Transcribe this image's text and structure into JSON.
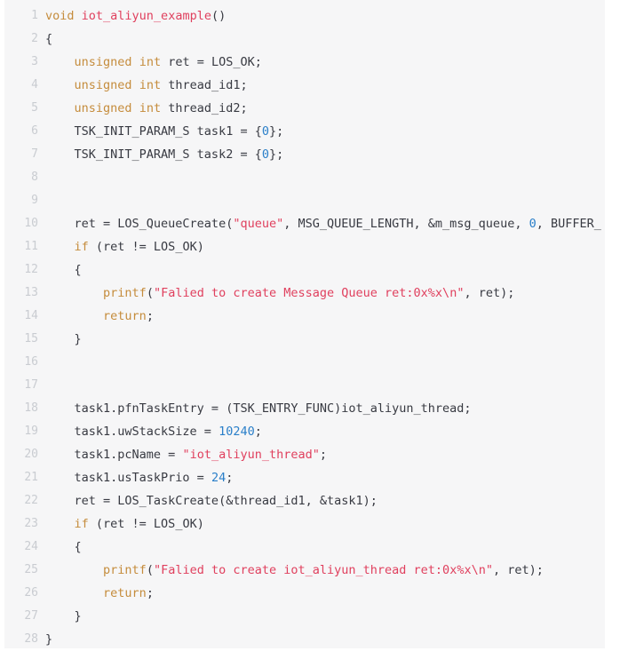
{
  "editor": {
    "language": "c",
    "first_line": 1,
    "last_line": 28,
    "total_lines": 28,
    "background": "#f6f6f7",
    "gutter_color": "#c9ccd1",
    "colors": {
      "keyword": "#c58c3c",
      "function": "#e0405e",
      "string": "#e0405e",
      "number": "#2a7fc9",
      "plain": "#383a42"
    }
  },
  "lines": [
    {
      "number": "1",
      "tokens": [
        {
          "t": "void",
          "c": "t-kw"
        },
        {
          "t": " ",
          "c": "t-pln"
        },
        {
          "t": "iot_aliyun_example",
          "c": "t-fn"
        },
        {
          "t": "()",
          "c": "t-pln"
        }
      ]
    },
    {
      "number": "2",
      "tokens": [
        {
          "t": "{",
          "c": "t-pln"
        }
      ]
    },
    {
      "number": "3",
      "tokens": [
        {
          "t": "    ",
          "c": "t-pln"
        },
        {
          "t": "unsigned",
          "c": "t-kw"
        },
        {
          "t": " ",
          "c": "t-pln"
        },
        {
          "t": "int",
          "c": "t-kw"
        },
        {
          "t": " ret = LOS_OK;",
          "c": "t-pln"
        }
      ]
    },
    {
      "number": "4",
      "tokens": [
        {
          "t": "    ",
          "c": "t-pln"
        },
        {
          "t": "unsigned",
          "c": "t-kw"
        },
        {
          "t": " ",
          "c": "t-pln"
        },
        {
          "t": "int",
          "c": "t-kw"
        },
        {
          "t": " thread_id1;",
          "c": "t-pln"
        }
      ]
    },
    {
      "number": "5",
      "tokens": [
        {
          "t": "    ",
          "c": "t-pln"
        },
        {
          "t": "unsigned",
          "c": "t-kw"
        },
        {
          "t": " ",
          "c": "t-pln"
        },
        {
          "t": "int",
          "c": "t-kw"
        },
        {
          "t": " thread_id2;",
          "c": "t-pln"
        }
      ]
    },
    {
      "number": "6",
      "tokens": [
        {
          "t": "    TSK_INIT_PARAM_S task1 = {",
          "c": "t-pln"
        },
        {
          "t": "0",
          "c": "t-num"
        },
        {
          "t": "};",
          "c": "t-pln"
        }
      ]
    },
    {
      "number": "7",
      "tokens": [
        {
          "t": "    TSK_INIT_PARAM_S task2 = {",
          "c": "t-pln"
        },
        {
          "t": "0",
          "c": "t-num"
        },
        {
          "t": "};",
          "c": "t-pln"
        }
      ]
    },
    {
      "number": "8",
      "tokens": []
    },
    {
      "number": "9",
      "tokens": []
    },
    {
      "number": "10",
      "tokens": [
        {
          "t": "    ret = LOS_QueueCreate(",
          "c": "t-pln"
        },
        {
          "t": "\"queue\"",
          "c": "t-str"
        },
        {
          "t": ", MSG_QUEUE_LENGTH, &m_msg_queue, ",
          "c": "t-pln"
        },
        {
          "t": "0",
          "c": "t-num"
        },
        {
          "t": ", BUFFER_",
          "c": "t-pln"
        }
      ]
    },
    {
      "number": "11",
      "tokens": [
        {
          "t": "    ",
          "c": "t-pln"
        },
        {
          "t": "if",
          "c": "t-kw"
        },
        {
          "t": " (ret != LOS_OK)",
          "c": "t-pln"
        }
      ]
    },
    {
      "number": "12",
      "tokens": [
        {
          "t": "    {",
          "c": "t-pln"
        }
      ]
    },
    {
      "number": "13",
      "tokens": [
        {
          "t": "        ",
          "c": "t-pln"
        },
        {
          "t": "printf",
          "c": "t-kw"
        },
        {
          "t": "(",
          "c": "t-pln"
        },
        {
          "t": "\"Falied to create Message Queue ret:0x%x\\n\"",
          "c": "t-str"
        },
        {
          "t": ", ret);",
          "c": "t-pln"
        }
      ]
    },
    {
      "number": "14",
      "tokens": [
        {
          "t": "        ",
          "c": "t-pln"
        },
        {
          "t": "return",
          "c": "t-kw"
        },
        {
          "t": ";",
          "c": "t-pln"
        }
      ]
    },
    {
      "number": "15",
      "tokens": [
        {
          "t": "    }",
          "c": "t-pln"
        }
      ]
    },
    {
      "number": "16",
      "tokens": []
    },
    {
      "number": "17",
      "tokens": []
    },
    {
      "number": "18",
      "tokens": [
        {
          "t": "    task1.pfnTaskEntry = (TSK_ENTRY_FUNC)iot_aliyun_thread;",
          "c": "t-pln"
        }
      ]
    },
    {
      "number": "19",
      "tokens": [
        {
          "t": "    task1.uwStackSize = ",
          "c": "t-pln"
        },
        {
          "t": "10240",
          "c": "t-num"
        },
        {
          "t": ";",
          "c": "t-pln"
        }
      ]
    },
    {
      "number": "20",
      "tokens": [
        {
          "t": "    task1.pcName = ",
          "c": "t-pln"
        },
        {
          "t": "\"iot_aliyun_thread\"",
          "c": "t-str"
        },
        {
          "t": ";",
          "c": "t-pln"
        }
      ]
    },
    {
      "number": "21",
      "tokens": [
        {
          "t": "    task1.usTaskPrio = ",
          "c": "t-pln"
        },
        {
          "t": "24",
          "c": "t-num"
        },
        {
          "t": ";",
          "c": "t-pln"
        }
      ]
    },
    {
      "number": "22",
      "tokens": [
        {
          "t": "    ret = LOS_TaskCreate(&thread_id1, &task1);",
          "c": "t-pln"
        }
      ]
    },
    {
      "number": "23",
      "tokens": [
        {
          "t": "    ",
          "c": "t-pln"
        },
        {
          "t": "if",
          "c": "t-kw"
        },
        {
          "t": " (ret != LOS_OK)",
          "c": "t-pln"
        }
      ]
    },
    {
      "number": "24",
      "tokens": [
        {
          "t": "    {",
          "c": "t-pln"
        }
      ]
    },
    {
      "number": "25",
      "tokens": [
        {
          "t": "        ",
          "c": "t-pln"
        },
        {
          "t": "printf",
          "c": "t-kw"
        },
        {
          "t": "(",
          "c": "t-pln"
        },
        {
          "t": "\"Falied to create iot_aliyun_thread ret:0x%x\\n\"",
          "c": "t-str"
        },
        {
          "t": ", ret);",
          "c": "t-pln"
        }
      ]
    },
    {
      "number": "26",
      "tokens": [
        {
          "t": "        ",
          "c": "t-pln"
        },
        {
          "t": "return",
          "c": "t-kw"
        },
        {
          "t": ";",
          "c": "t-pln"
        }
      ]
    },
    {
      "number": "27",
      "tokens": [
        {
          "t": "    }",
          "c": "t-pln"
        }
      ]
    },
    {
      "number": "28",
      "tokens": [
        {
          "t": "}",
          "c": "t-pln"
        }
      ]
    }
  ]
}
